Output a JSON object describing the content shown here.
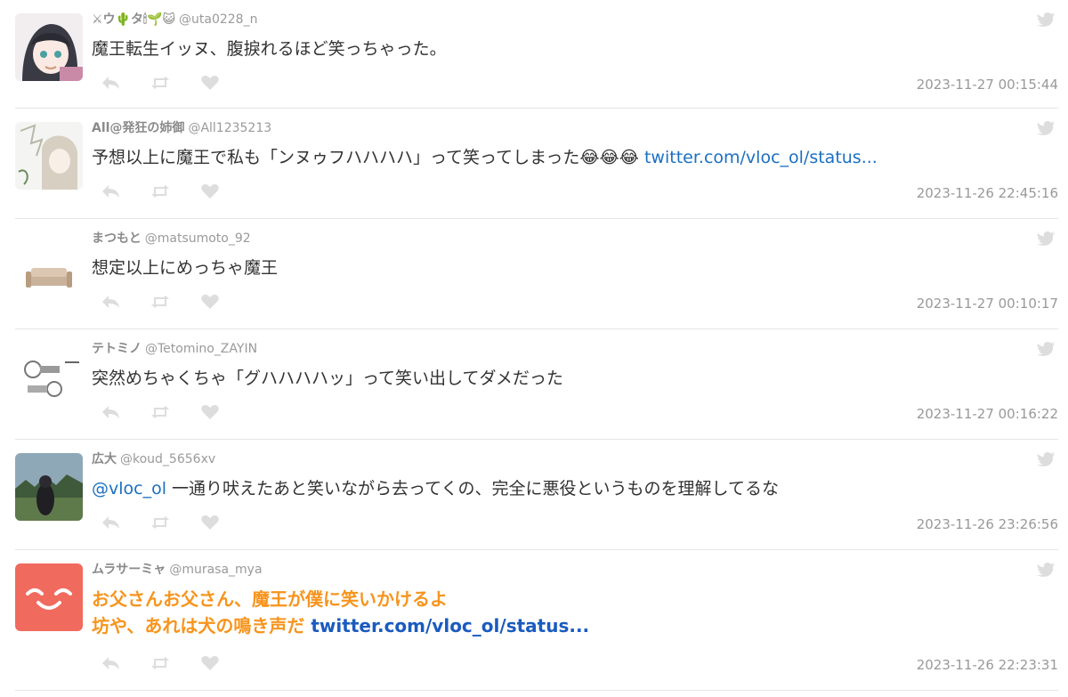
{
  "tweets": [
    {
      "name": "⚔ウ🌵タ🕯🌱😺",
      "handle": "@uta0228_n",
      "text": "魔王転生イッヌ、腹捩れるほど笑っちゃった。",
      "timestamp": "2023-11-27 00:15:44"
    },
    {
      "name": "All@発狂の姉御",
      "handle": "@All1235213",
      "text": "予想以上に魔王で私も「ンヌゥフハハハハ」って笑ってしまった😂😂😂 ",
      "link": "twitter.com/vloc_ol/status...",
      "timestamp": "2023-11-26 22:45:16"
    },
    {
      "name": "まつもと",
      "handle": "@matsumoto_92",
      "text": "想定以上にめっちゃ魔王",
      "timestamp": "2023-11-27 00:10:17"
    },
    {
      "name": "テトミノ",
      "handle": "@Tetomino_ZAYIN",
      "text": "突然めちゃくちゃ「グハハハハッ」って笑い出してダメだった",
      "timestamp": "2023-11-27 00:16:22"
    },
    {
      "name": "広大",
      "handle": "@koud_5656xv",
      "mention": "@vloc_ol",
      "text": " 一通り吠えたあと笑いながら去ってくの、完全に悪役というものを理解してるな",
      "timestamp": "2023-11-26 23:26:56"
    },
    {
      "name": "ムラサーミャ",
      "handle": "@murasa_mya",
      "line1": "お父さんお父さん、魔王が僕に笑いかけるよ",
      "line2": "坊や、あれは犬の鳴き声だ ",
      "link": "twitter.com/vloc_ol/status...",
      "timestamp": "2023-11-26 22:23:31"
    }
  ],
  "icons": {
    "reply": "reply-icon",
    "retweet": "retweet-icon",
    "like": "heart-icon",
    "source": "twitter-bird-icon"
  },
  "colors": {
    "link": "#1a6fc2",
    "highlight_text": "#f7941d",
    "icon_gray": "#dddddd",
    "avatar6_bg": "#f06a5e"
  }
}
